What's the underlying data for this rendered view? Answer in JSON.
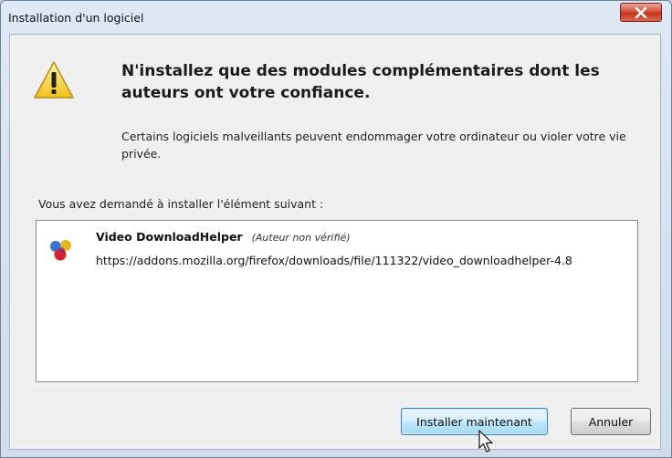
{
  "window": {
    "title": "Installation d'un logiciel"
  },
  "warning": {
    "headline": "N'installez que des modules complémentaires dont les auteurs ont votre confiance.",
    "description": "Certains logiciels malveillants peuvent endommager votre ordinateur ou violer votre vie privée."
  },
  "request": {
    "label": "Vous avez demandé à installer l'élément suivant :"
  },
  "addons": [
    {
      "name": "Video DownloadHelper",
      "author_note": "(Auteur non vérifié)",
      "url": "https://addons.mozilla.org/firefox/downloads/file/111322/video_downloadhelper-4.8"
    }
  ],
  "buttons": {
    "install_label": "Installer maintenant",
    "cancel_label": "Annuler"
  },
  "icons": {
    "close": "close-icon",
    "warning": "warning-icon",
    "addon": "addon-icon",
    "cursor": "mouse-cursor-icon"
  },
  "colors": {
    "close_button": "#c9412b",
    "warning_yellow": "#f3c822",
    "install_button_border": "#3c7fb1"
  }
}
